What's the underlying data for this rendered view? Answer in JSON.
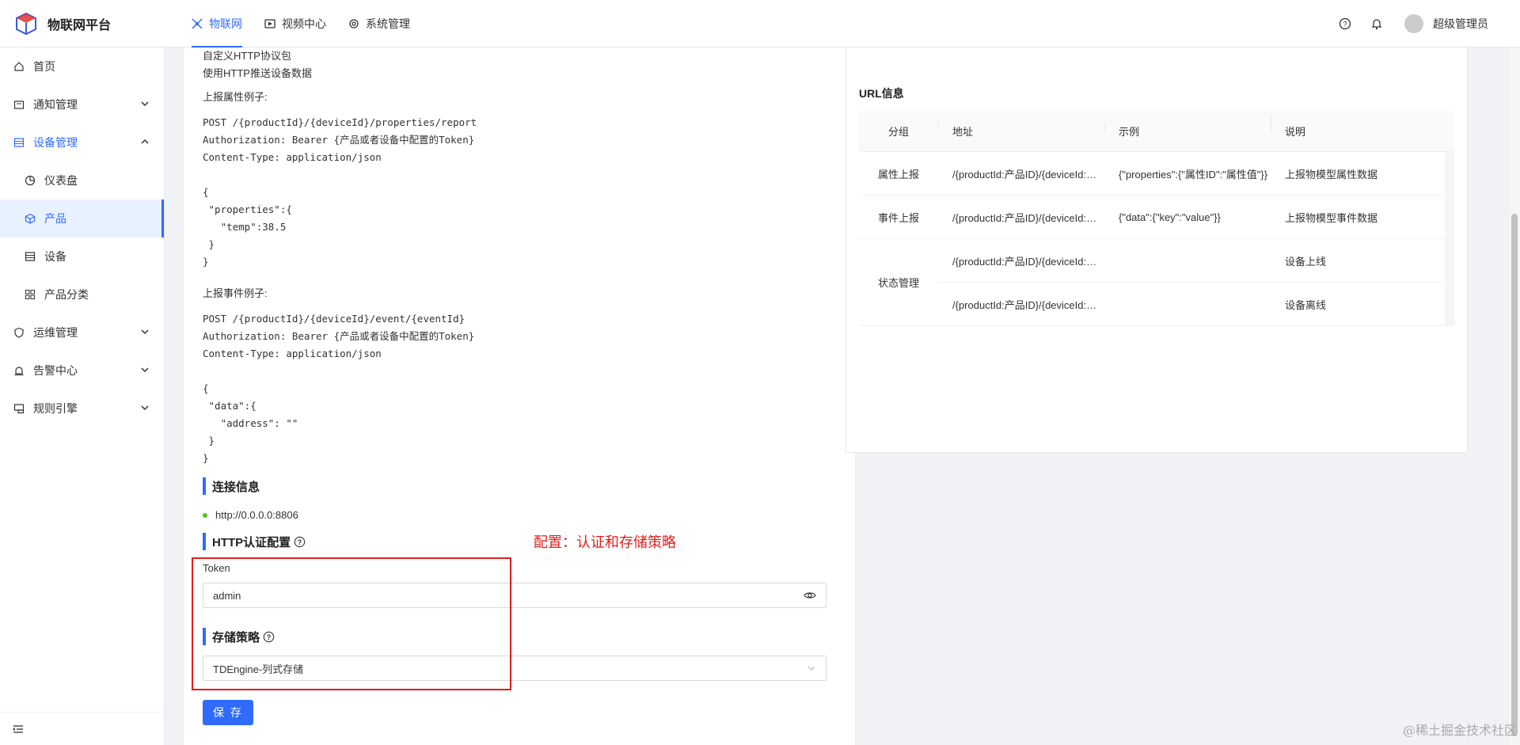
{
  "app": {
    "title": "物联网平台"
  },
  "topnav": [
    {
      "label": "物联网",
      "icon": "iot-icon",
      "active": true
    },
    {
      "label": "视频中心",
      "icon": "video-icon",
      "active": false
    },
    {
      "label": "系统管理",
      "icon": "settings-icon",
      "active": false
    }
  ],
  "user": {
    "name": "超级管理员"
  },
  "sidebar": {
    "items": [
      {
        "label": "首页"
      },
      {
        "label": "通知管理"
      },
      {
        "label": "设备管理"
      },
      {
        "label": "仪表盘"
      },
      {
        "label": "产品"
      },
      {
        "label": "设备"
      },
      {
        "label": "产品分类"
      },
      {
        "label": "运维管理"
      },
      {
        "label": "告警中心"
      },
      {
        "label": "规则引擎"
      }
    ]
  },
  "doc": {
    "line1": "自定义HTTP协议包",
    "line2": "使用HTTP推送设备数据",
    "prop_example_label": "上报属性例子:",
    "prop_code": "POST /{productId}/{deviceId}/properties/report\nAuthorization: Bearer {产品或者设备中配置的Token}\nContent-Type: application/json\n\n{\n \"properties\":{\n   \"temp\":38.5\n }\n}",
    "event_example_label": "上报事件例子:",
    "event_code": "POST /{productId}/{deviceId}/event/{eventId}\nAuthorization: Bearer {产品或者设备中配置的Token}\nContent-Type: application/json\n\n{\n \"data\":{\n   \"address\": \"\"\n }\n}"
  },
  "connection": {
    "title": "连接信息",
    "url": "http://0.0.0.0:8806"
  },
  "auth": {
    "title": "HTTP认证配置",
    "token_label": "Token",
    "token_value": "admin"
  },
  "storage": {
    "title": "存储策略",
    "value": "TDEngine-列式存储"
  },
  "save_label": "保 存",
  "annotation": "配置：认证和存储策略",
  "url_info": {
    "title": "URL信息",
    "headers": [
      "分组",
      "地址",
      "示例",
      "说明"
    ],
    "rows": [
      {
        "group": "属性上报",
        "address": "/{productId:产品ID}/{deviceId:设备ID}/properties/report",
        "example": "{\"properties\":{\"属性ID\":\"属性值\"}}",
        "desc": "上报物模型属性数据"
      },
      {
        "group": "事件上报",
        "address": "/{productId:产品ID}/{deviceId:设备ID}/event/{eventId}",
        "example": "{\"data\":{\"key\":\"value\"}}",
        "desc": "上报物模型事件数据"
      }
    ],
    "status_group": "状态管理",
    "status_rows": [
      {
        "address": "/{productId:产品ID}/{deviceId:设备ID}/online",
        "example": "",
        "desc": "设备上线"
      },
      {
        "address": "/{productId:产品ID}/{deviceId:设备ID}/offline",
        "example": "",
        "desc": "设备离线"
      }
    ]
  },
  "watermark": "@稀土掘金技术社区"
}
